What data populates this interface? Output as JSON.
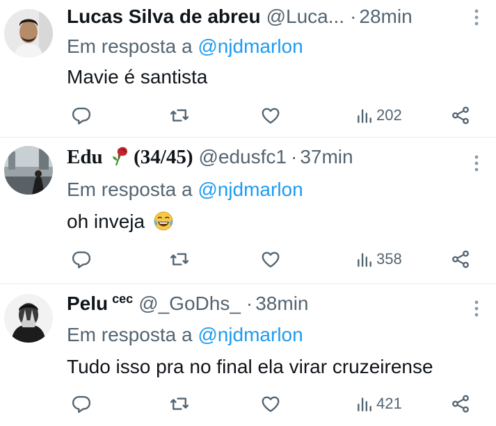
{
  "tweets": [
    {
      "name": "Lucas Silva de abreu",
      "handle": "@Luca...",
      "separator": "·",
      "time": "28min",
      "reply_prefix": "Em resposta a",
      "reply_mention": "@njdmarlon",
      "text": "Mavie é santista",
      "views": "202"
    },
    {
      "name": "Edu",
      "name_suffix": "(34/45)",
      "handle": "@edusfc1",
      "separator": "·",
      "time": "37min",
      "reply_prefix": "Em resposta a",
      "reply_mention": "@njdmarlon",
      "text": "oh inveja",
      "views": "358"
    },
    {
      "name": "Pelu",
      "name_sup": "cec",
      "handle": "@_GoDhs_",
      "separator": "·",
      "time": "38min",
      "reply_prefix": "Em resposta a",
      "reply_mention": "@njdmarlon",
      "text": "Tudo isso pra no final ela virar cruzeirense",
      "views": "421"
    }
  ],
  "icons": {
    "reply": "speech-bubble-icon",
    "retweet": "retweet-arrows-icon",
    "like": "heart-outline-icon",
    "views": "bar-chart-icon",
    "share": "share-nodes-icon",
    "more": "vertical-ellipsis-icon",
    "rose": "wilted-rose-emoji",
    "laugh": "tears-of-joy-emoji"
  },
  "colors": {
    "text": "#0f1419",
    "muted": "#536471",
    "link": "#1d9bf0",
    "divider": "#e6ecf0"
  }
}
